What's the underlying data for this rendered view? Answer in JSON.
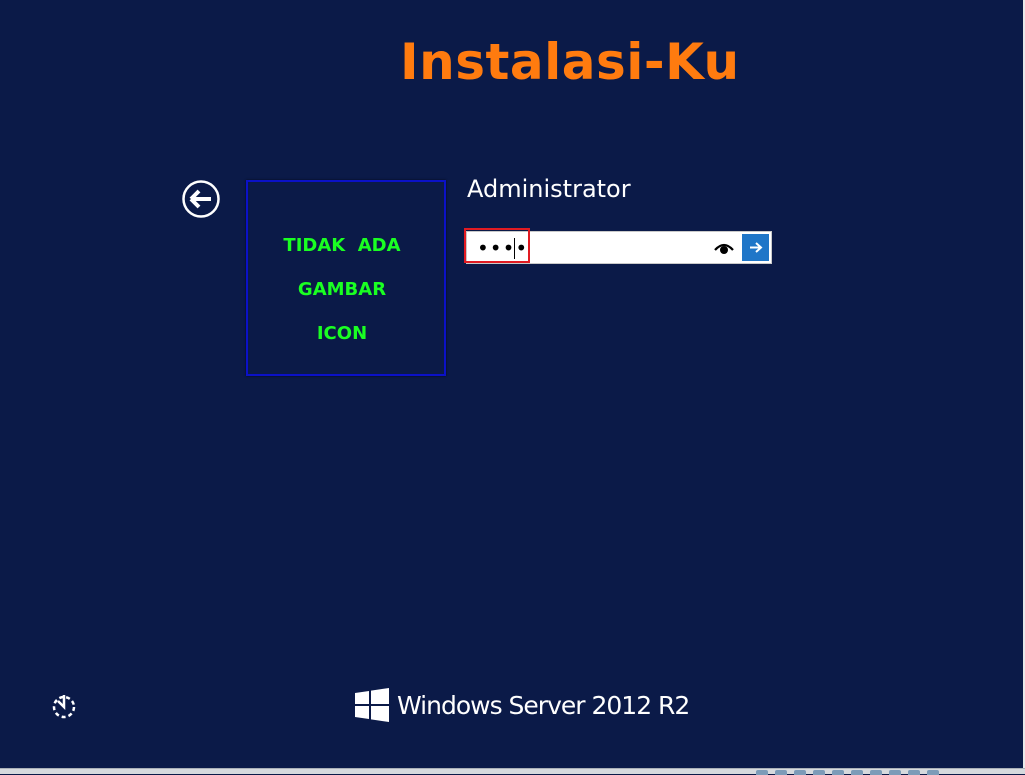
{
  "header": {
    "title": "Instalasi-Ku"
  },
  "avatar": {
    "lines": [
      "TIDAK  ADA",
      "GAMBAR",
      "ICON"
    ]
  },
  "login": {
    "username": "Administrator",
    "password_masked": "••••"
  },
  "footer": {
    "brand": "Windows Server 2012 R2"
  },
  "icons": {
    "back": "back-arrow-icon",
    "reveal": "eye-icon",
    "submit": "arrow-right-icon",
    "ease": "ease-of-access-icon",
    "logo": "windows-logo-icon"
  },
  "colors": {
    "background": "#0b1a48",
    "title": "#ff7b0f",
    "avatar_text": "#1aff22",
    "avatar_border": "#0b11c8",
    "submit": "#1f76c8",
    "highlight": "#e11b22"
  }
}
